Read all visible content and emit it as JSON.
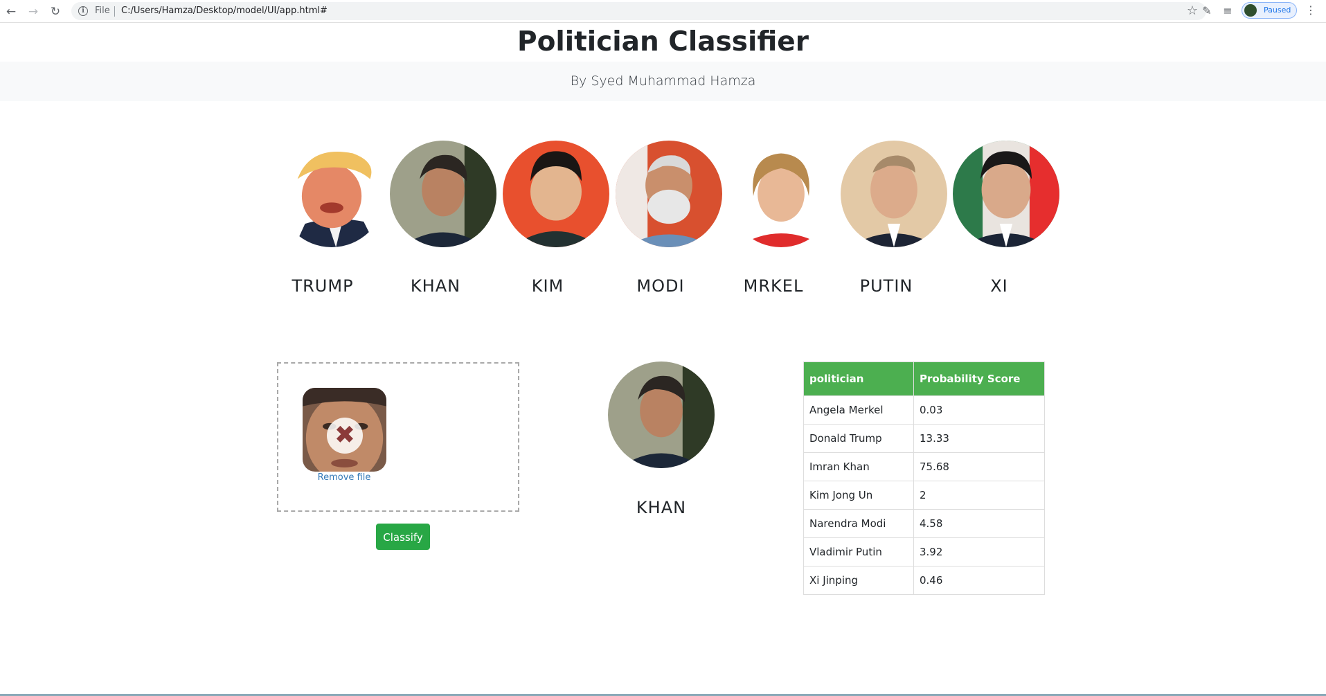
{
  "browser": {
    "scheme_label": "File",
    "url": "C:/Users/Hamza/Desktop/model/UI/app.html#",
    "profile_label": "Paused"
  },
  "header": {
    "title": "Politician Classifier",
    "subtitle": "By Syed Muhammad Hamza"
  },
  "gallery": [
    {
      "name": "TRUMP",
      "icon": "trump-photo"
    },
    {
      "name": "KHAN",
      "icon": "khan-photo"
    },
    {
      "name": "KIM",
      "icon": "kim-photo"
    },
    {
      "name": "MODI",
      "icon": "modi-photo"
    },
    {
      "name": "MRKEL",
      "icon": "merkel-photo"
    },
    {
      "name": "PUTIN",
      "icon": "putin-photo"
    },
    {
      "name": "XI",
      "icon": "xi-photo"
    }
  ],
  "upload": {
    "remove_label": "Remove file",
    "classify_label": "Classify"
  },
  "result": {
    "name": "KHAN"
  },
  "table": {
    "headers": [
      "politician",
      "Probability Score"
    ],
    "rows": [
      [
        "Angela Merkel",
        "0.03"
      ],
      [
        "Donald Trump",
        "13.33"
      ],
      [
        "Imran Khan",
        "75.68"
      ],
      [
        "Kim Jong Un",
        "2"
      ],
      [
        "Narendra Modi",
        "4.58"
      ],
      [
        "Vladimir Putin",
        "3.92"
      ],
      [
        "Xi Jinping",
        "0.46"
      ]
    ]
  },
  "colors": {
    "table_header": "#4caf50",
    "classify_button": "#28a745",
    "link": "#3379b7"
  }
}
